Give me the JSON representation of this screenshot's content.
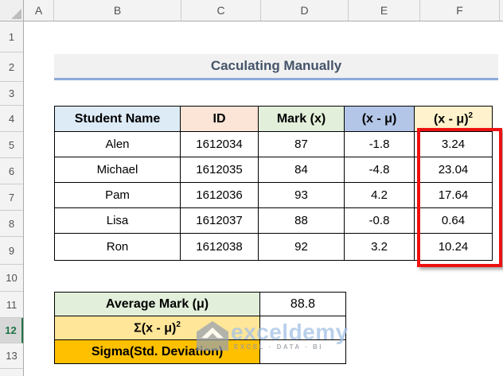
{
  "colors": {
    "title_text": "#44546A",
    "title_underline": "#8EA9DB",
    "header_student_bg": "#DDEBF7",
    "header_id_bg": "#FCE4D6",
    "header_mark_bg": "#E2EFDA",
    "header_diff_bg": "#B4C6E7",
    "header_diffsq_bg": "#FFF2CC",
    "summary_avg_bg": "#E2EFDA",
    "summary_sum_bg": "#FFE699",
    "summary_sigma_bg": "#FFC000",
    "highlight_border": "#EE1111",
    "active_row_accent": "#217346"
  },
  "spreadsheet": {
    "column_headers": [
      "A",
      "B",
      "C",
      "D",
      "E",
      "F"
    ],
    "row_headers": [
      "1",
      "2",
      "3",
      "4",
      "5",
      "6",
      "7",
      "8",
      "9",
      "10",
      "11",
      "12",
      "13"
    ],
    "active_row": "12"
  },
  "title": {
    "text": "Caculating Manually"
  },
  "table": {
    "headers": {
      "student": "Student Name",
      "id": "ID",
      "mark": "Mark (x)",
      "diff": "(x - μ)",
      "diff_sq_base": "(x - μ)",
      "diff_sq_sup": "2"
    },
    "rows": [
      {
        "name": "Alen",
        "id": "1612034",
        "mark": "87",
        "diff": "-1.8",
        "diff_sq": "3.24"
      },
      {
        "name": "Michael",
        "id": "1612035",
        "mark": "84",
        "diff": "-4.8",
        "diff_sq": "23.04"
      },
      {
        "name": "Pam",
        "id": "1612036",
        "mark": "93",
        "diff": "4.2",
        "diff_sq": "17.64"
      },
      {
        "name": "Lisa",
        "id": "1612037",
        "mark": "88",
        "diff": "-0.8",
        "diff_sq": "0.64"
      },
      {
        "name": "Ron",
        "id": "1612038",
        "mark": "92",
        "diff": "3.2",
        "diff_sq": "10.24"
      }
    ]
  },
  "summary": {
    "avg_label": "Average Mark (μ)",
    "avg_value": "88.8",
    "sum_label_base": "Σ(x - μ)",
    "sum_label_sup": "2",
    "sum_value": "",
    "sigma_label": "Sigma(Std. Deviation)",
    "sigma_value": ""
  },
  "watermark": {
    "brand": "exceldemy",
    "tagline": "EXCEL · DATA · BI"
  }
}
